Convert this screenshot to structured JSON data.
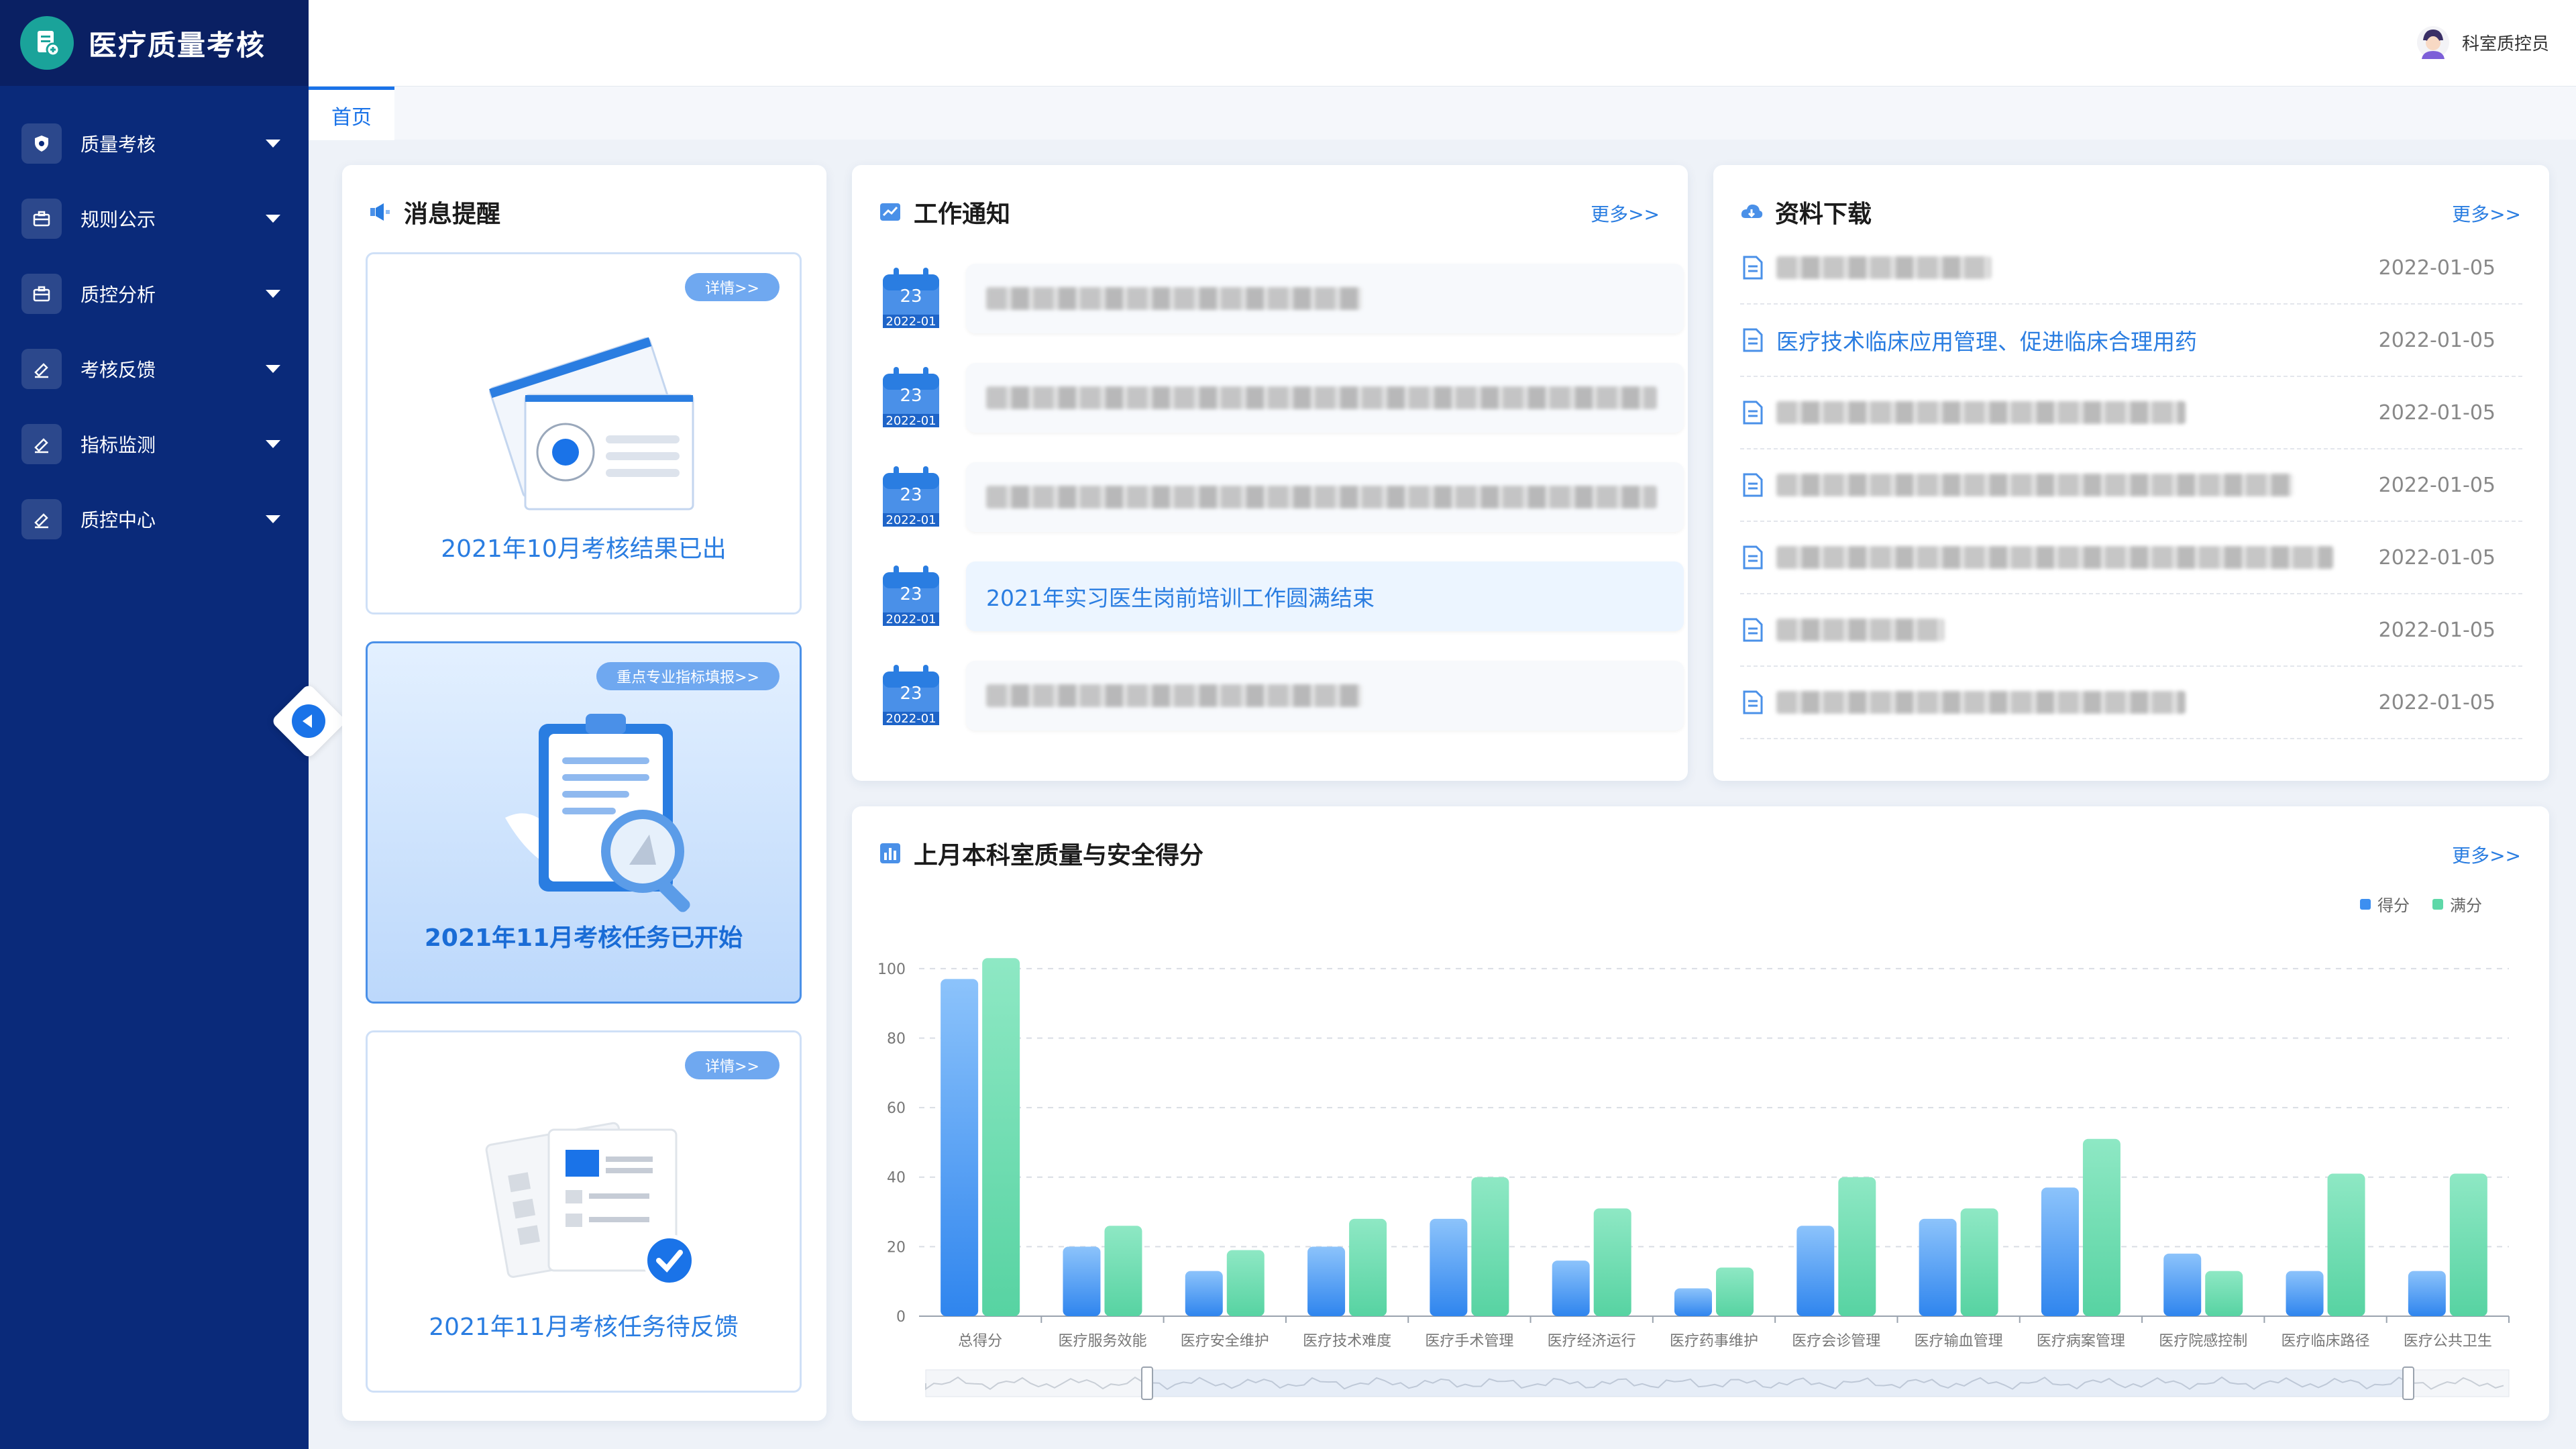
{
  "app": {
    "title": "医疗质量考核"
  },
  "sidebar": {
    "items": [
      {
        "label": "质量考核",
        "icon": "shield-icon"
      },
      {
        "label": "规则公示",
        "icon": "briefcase-icon"
      },
      {
        "label": "质控分析",
        "icon": "briefcase-icon"
      },
      {
        "label": "考核反馈",
        "icon": "pen-icon"
      },
      {
        "label": "指标监测",
        "icon": "pen-icon"
      },
      {
        "label": "质控中心",
        "icon": "pen-icon"
      }
    ]
  },
  "header": {
    "user_name": "科室质控员"
  },
  "tabs": [
    {
      "label": "首页"
    }
  ],
  "messages": {
    "title": "消息提醒",
    "cards": [
      {
        "badge": "详情>>",
        "caption": "2021年10月考核结果已出"
      },
      {
        "badge": "重点专业指标填报>>",
        "caption": "2021年11月考核任务已开始"
      },
      {
        "badge": "详情>>",
        "caption": "2021年11月考核任务待反馈"
      }
    ]
  },
  "notices": {
    "title": "工作通知",
    "more": "更多>>",
    "items": [
      {
        "day": "23",
        "date": "2022-01",
        "text": ""
      },
      {
        "day": "23",
        "date": "2022-01",
        "text": ""
      },
      {
        "day": "23",
        "date": "2022-01",
        "text": ""
      },
      {
        "day": "23",
        "date": "2022-01",
        "text": "2021年实习医生岗前培训工作圆满结束"
      },
      {
        "day": "23",
        "date": "2022-01",
        "text": ""
      }
    ]
  },
  "downloads": {
    "title": "资料下载",
    "more": "更多>>",
    "items": [
      {
        "title": "",
        "date": "2022-01-05"
      },
      {
        "title": "医疗技术临床应用管理、促进临床合理用药",
        "date": "2022-01-05"
      },
      {
        "title": "",
        "date": "2022-01-05"
      },
      {
        "title": "",
        "date": "2022-01-05"
      },
      {
        "title": "",
        "date": "2022-01-05"
      },
      {
        "title": "",
        "date": "2022-01-05"
      },
      {
        "title": "",
        "date": "2022-01-05"
      }
    ]
  },
  "score_panel": {
    "title": "上月本科室质量与安全得分",
    "more": "更多>>",
    "legend": [
      {
        "name": "得分",
        "color": "#3d8ff0"
      },
      {
        "name": "满分",
        "color": "#5ed8a8"
      }
    ]
  },
  "chart_data": {
    "type": "bar",
    "categories": [
      "总得分",
      "医疗服务效能",
      "医疗安全维护",
      "医疗技术难度",
      "医疗手术管理",
      "医疗经济运行",
      "医疗药事维护",
      "医疗会诊管理",
      "医疗输血管理",
      "医疗病案管理",
      "医疗院感控制",
      "医疗临床路径",
      "医疗公共卫生"
    ],
    "series": [
      {
        "name": "得分",
        "values": [
          97,
          20,
          13,
          20,
          28,
          16,
          8,
          26,
          28,
          37,
          18,
          13,
          13
        ]
      },
      {
        "name": "满分",
        "values": [
          103,
          26,
          19,
          28,
          40,
          31,
          14,
          40,
          31,
          51,
          13,
          41,
          41
        ]
      }
    ],
    "yticks": [
      0,
      20,
      40,
      60,
      80,
      100
    ],
    "ylim": [
      0,
      110
    ],
    "grid": true,
    "legend_position": "top-right"
  }
}
